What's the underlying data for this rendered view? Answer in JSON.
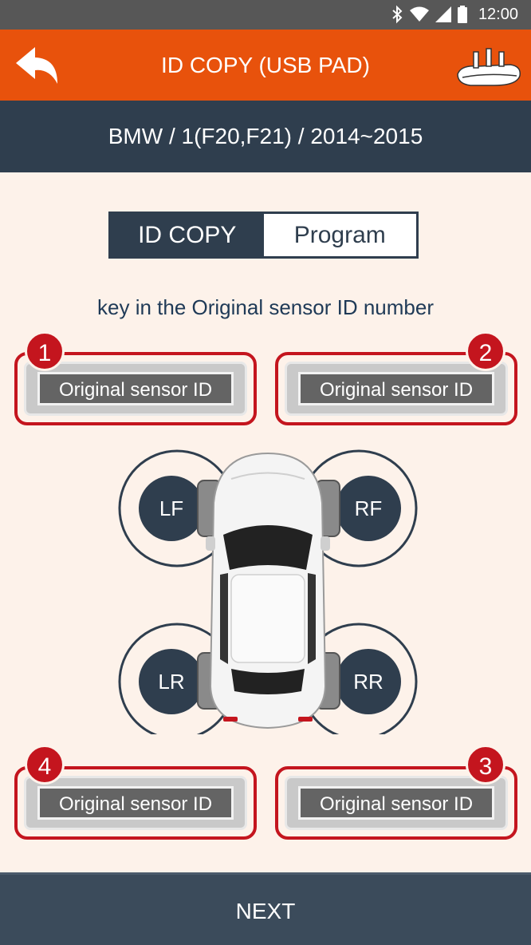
{
  "status_bar": {
    "time": "12:00"
  },
  "app_bar": {
    "title": "ID COPY (USB PAD)"
  },
  "vehicle": {
    "path": "BMW / 1(F20,F21) / 2014~2015"
  },
  "mode_toggle": {
    "active": "ID COPY",
    "inactive": "Program"
  },
  "instruction": "key in the Original sensor ID number",
  "sensors": [
    {
      "badge": "1",
      "label": "Original sensor ID"
    },
    {
      "badge": "2",
      "label": "Original sensor ID"
    },
    {
      "badge": "3",
      "label": "Original sensor ID"
    },
    {
      "badge": "4",
      "label": "Original sensor ID"
    }
  ],
  "wheels": {
    "lf": "LF",
    "rf": "RF",
    "lr": "LR",
    "rr": "RR"
  },
  "colors": {
    "accent": "#e8520c",
    "dark": "#2f3e4e",
    "alert": "#c4151e",
    "background": "#fdf2ea"
  },
  "next_label": "NEXT"
}
